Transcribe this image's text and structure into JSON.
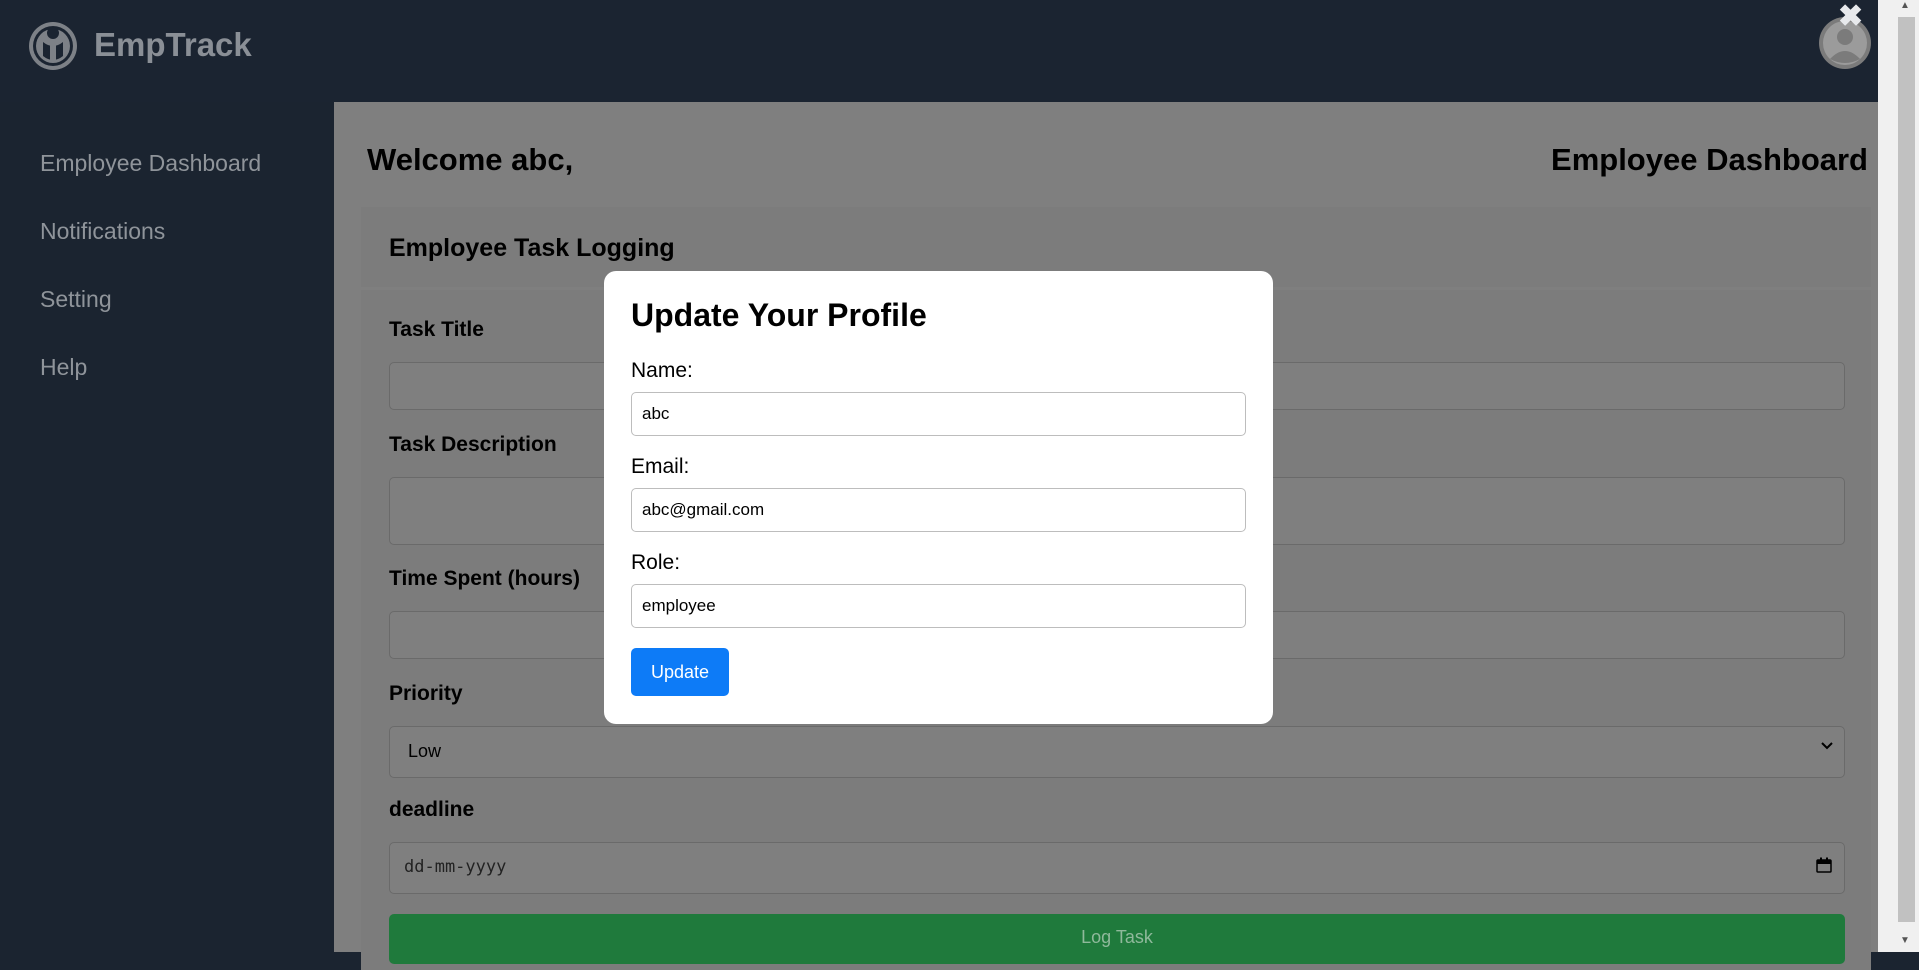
{
  "header": {
    "brand": "EmpTrack",
    "close_symbol": "✖"
  },
  "sidebar": {
    "items": [
      {
        "label": "Employee Dashboard"
      },
      {
        "label": "Notifications"
      },
      {
        "label": "Setting"
      },
      {
        "label": "Help"
      }
    ]
  },
  "main": {
    "welcome": "Welcome abc,",
    "page_title": "Employee Dashboard",
    "section_title": "Employee Task Logging",
    "form": {
      "task_title_label": "Task Title",
      "task_description_label": "Task Description",
      "time_spent_label": "Time Spent (hours)",
      "priority_label": "Priority",
      "priority_value": "Low",
      "deadline_label": "deadline",
      "deadline_placeholder": "dd-mm-yyyy",
      "submit_label": "Log Task"
    }
  },
  "modal": {
    "title": "Update Your Profile",
    "name_label": "Name:",
    "name_value": "abc",
    "email_label": "Email:",
    "email_value": "abc@gmail.com",
    "role_label": "Role:",
    "role_value": "employee",
    "update_label": "Update"
  },
  "colors": {
    "sidebar_bg": "#1b2430",
    "overlay_bg": "#7f7f7f",
    "primary_button": "#0d7bf7",
    "log_button": "#1f7a3c"
  }
}
